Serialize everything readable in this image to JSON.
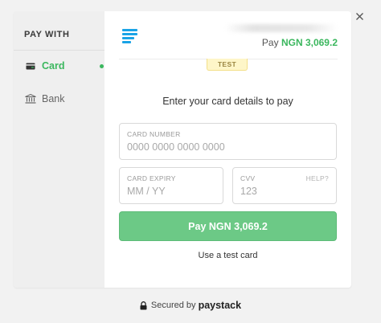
{
  "sidebar": {
    "title": "PAY WITH",
    "items": [
      {
        "label": "Card",
        "icon": "card-icon",
        "active": true
      },
      {
        "label": "Bank",
        "icon": "bank-icon",
        "active": false
      }
    ]
  },
  "header": {
    "pay_prefix": "Pay",
    "amount": "NGN 3,069.2",
    "mode_badge": "TEST"
  },
  "form": {
    "instruction": "Enter your card details to pay",
    "card_number": {
      "label": "CARD NUMBER",
      "placeholder": "0000 0000 0000 0000",
      "value": ""
    },
    "card_expiry": {
      "label": "CARD EXPIRY",
      "placeholder": "MM / YY",
      "value": ""
    },
    "cvv": {
      "label": "CVV",
      "placeholder": "123",
      "value": "",
      "help": "HELP?"
    },
    "pay_button": "Pay NGN 3,069.2",
    "test_card_link": "Use a test card"
  },
  "footer": {
    "secured_by": "Secured by",
    "brand": "paystack"
  },
  "colors": {
    "accent_green": "#3bb75e",
    "button_green": "#6cc986",
    "logo_blue": "#1aa3e6",
    "badge_yellow": "#fef6c8"
  }
}
